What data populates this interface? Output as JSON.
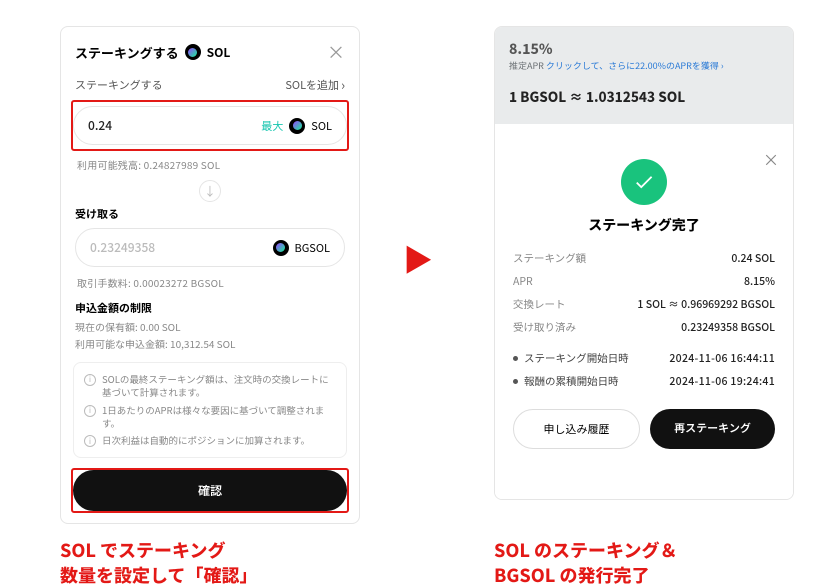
{
  "left": {
    "title": "ステーキングする",
    "asset": "SOL",
    "add_label": "SOLを追加",
    "sub_label": "ステーキングする",
    "amount_value": "0.24",
    "max_label": "最大",
    "balance_line": "利用可能残高: 0.24827989 SOL",
    "receive_label": "受け取る",
    "receive_value": "0.23249358",
    "receive_asset": "BGSOL",
    "fee_line": "取引手数料: 0.00023272 BGSOL",
    "limits_title": "申込金額の制限",
    "limits_lines": [
      "現在の保有額: 0.00 SOL",
      "利用可能な申込金額: 10,312.54 SOL"
    ],
    "infos": [
      "SOLの最終ステーキング額は、注文時の交換レートに基づいて計算されます。",
      "1日あたりのAPRは様々な要因に基づいて調整されます。",
      "日次利益は自動的にポジションに加算されます。"
    ],
    "confirm": "確認"
  },
  "right": {
    "top_pct": "8.15%",
    "top_line_prefix": "推定APR ",
    "top_link": "クリックして、さらに22.00%のAPRを獲得 ›",
    "rate_line": "1 BGSOL ≈ 1.0312543 SOL",
    "done_title": "ステーキング完了",
    "rows": [
      {
        "k": "ステーキング額",
        "v": "0.24 SOL"
      },
      {
        "k": "APR",
        "v": "8.15%"
      },
      {
        "k": "交換レート",
        "v": "1 SOL ≈ 0.96969292 BGSOL"
      },
      {
        "k": "受け取り済み",
        "v": "0.23249358 BGSOL"
      }
    ],
    "times": [
      {
        "k": "ステーキング開始日時",
        "v": "2024-11-06 16:44:11"
      },
      {
        "k": "報酬の累積開始日時",
        "v": "2024-11-06 19:24:41"
      }
    ],
    "history_btn": "申し込み履歴",
    "restake_btn": "再ステーキング"
  },
  "captions": {
    "left": "SOL でステーキング\n数量を設定して「確認」",
    "right": "SOL のステーキング＆\nBGSOL の発行完了"
  }
}
